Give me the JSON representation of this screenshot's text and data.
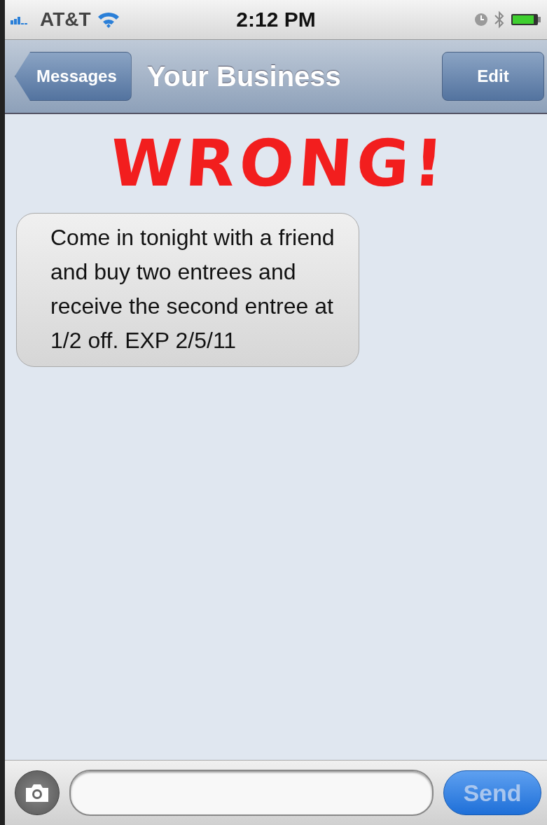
{
  "status_bar": {
    "carrier": "AT&T",
    "time": "2:12 PM"
  },
  "nav_bar": {
    "back": "Messages",
    "title": "Your Business",
    "action": "Edit"
  },
  "annotation": "WRONG!",
  "messages": [
    {
      "text": "Come in tonight with a friend and buy two entrees and receive the second entree at 1/2 off. EXP 2/5/11",
      "kind": "incoming"
    }
  ],
  "compose": {
    "send": "Send",
    "send_disabled": true
  }
}
